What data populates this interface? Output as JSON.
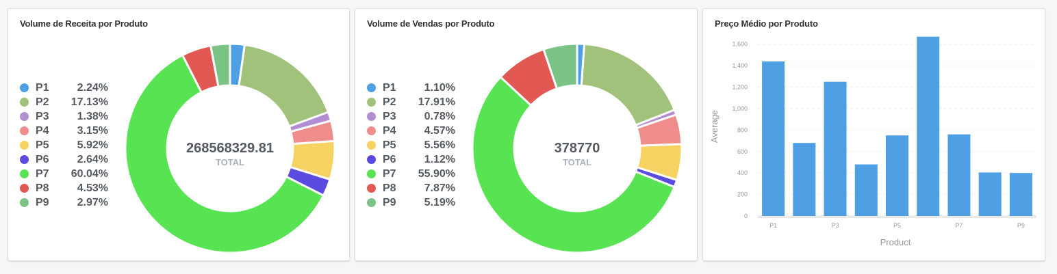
{
  "colors": {
    "P1": "#4f9fe5",
    "P2": "#a0c27a",
    "P3": "#b28fd3",
    "P4": "#ee8d8b",
    "P5": "#f6d263",
    "P6": "#5c4be0",
    "P7": "#58e352",
    "P8": "#e25852",
    "P9": "#7cc486",
    "bar": "#4f9fe5"
  },
  "chart_data": [
    {
      "type": "pie",
      "title": "Volume de Receita por Produto",
      "center_value": "268568329.81",
      "center_label": "TOTAL",
      "slices": [
        {
          "name": "P1",
          "pct": "2.24%",
          "value": 2.24
        },
        {
          "name": "P2",
          "pct": "17.13%",
          "value": 17.13
        },
        {
          "name": "P3",
          "pct": "1.38%",
          "value": 1.38
        },
        {
          "name": "P4",
          "pct": "3.15%",
          "value": 3.15
        },
        {
          "name": "P5",
          "pct": "5.92%",
          "value": 5.92
        },
        {
          "name": "P6",
          "pct": "2.64%",
          "value": 2.64
        },
        {
          "name": "P7",
          "pct": "60.04%",
          "value": 60.04
        },
        {
          "name": "P8",
          "pct": "4.53%",
          "value": 4.53
        },
        {
          "name": "P9",
          "pct": "2.97%",
          "value": 2.97
        }
      ],
      "legend_position": "left"
    },
    {
      "type": "pie",
      "title": "Volume de Vendas por Produto",
      "center_value": "378770",
      "center_label": "TOTAL",
      "slices": [
        {
          "name": "P1",
          "pct": "1.10%",
          "value": 1.1
        },
        {
          "name": "P2",
          "pct": "17.91%",
          "value": 17.91
        },
        {
          "name": "P3",
          "pct": "0.78%",
          "value": 0.78
        },
        {
          "name": "P4",
          "pct": "4.57%",
          "value": 4.57
        },
        {
          "name": "P5",
          "pct": "5.56%",
          "value": 5.56
        },
        {
          "name": "P6",
          "pct": "1.12%",
          "value": 1.12
        },
        {
          "name": "P7",
          "pct": "55.90%",
          "value": 55.9
        },
        {
          "name": "P8",
          "pct": "7.87%",
          "value": 7.87
        },
        {
          "name": "P9",
          "pct": "5.19%",
          "value": 5.19
        }
      ],
      "legend_position": "left"
    },
    {
      "type": "bar",
      "title": "Preço Médio por Produto",
      "xlabel": "Product",
      "ylabel": "Average",
      "categories": [
        "P1",
        "P2",
        "P3",
        "P4",
        "P5",
        "P6",
        "P7",
        "P8",
        "P9"
      ],
      "x_tick_labels": [
        "P1",
        "",
        "P3",
        "",
        "P5",
        "",
        "P7",
        "",
        "P9"
      ],
      "values": [
        1440,
        680,
        1250,
        480,
        750,
        1670,
        760,
        405,
        400
      ],
      "ylim": [
        0,
        1700
      ],
      "y_ticks": [
        0,
        200,
        400,
        600,
        800,
        1000,
        1200,
        1400,
        1600
      ],
      "y_tick_labels": [
        "0",
        "200",
        "400",
        "600",
        "800",
        "1,000",
        "1,200",
        "1,400",
        "1,600"
      ],
      "grid": true
    }
  ]
}
